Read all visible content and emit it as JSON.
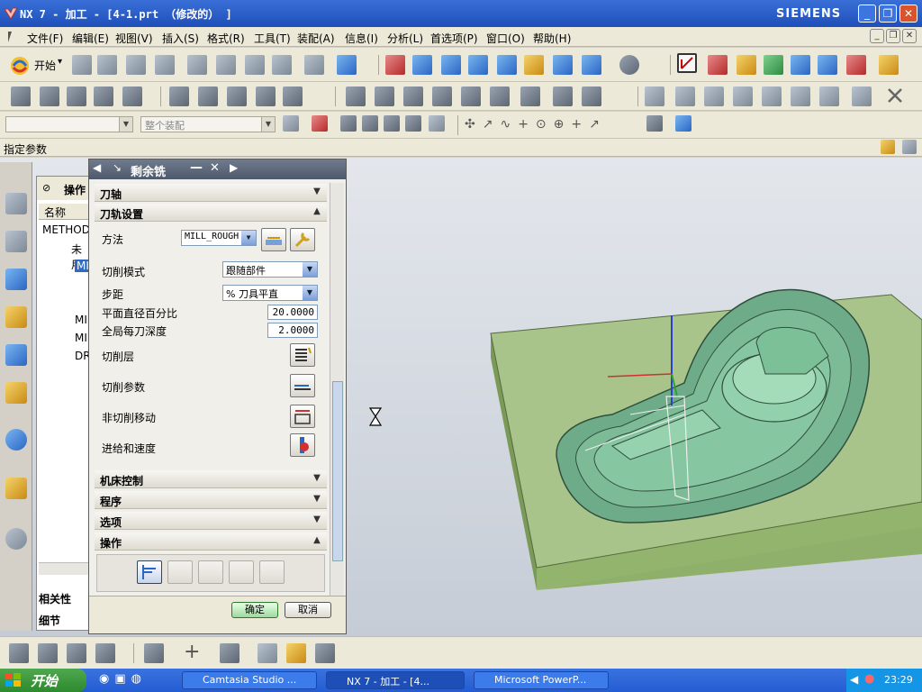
{
  "window": {
    "title": "NX 7 - 加工 - [4-1.prt （修改的） ]",
    "brand": "SIEMENS",
    "min": "_",
    "max": "❐",
    "close": "✕"
  },
  "menubar": {
    "items": [
      "文件(F)",
      "编辑(E)",
      "视图(V)",
      "插入(S)",
      "格式(R)",
      "工具(T)",
      "装配(A)",
      "信息(I)",
      "分析(L)",
      "首选项(P)",
      "窗口(O)",
      "帮助(H)"
    ]
  },
  "toolbar": {
    "start_label": "开始",
    "start_arrow": "▾",
    "filter_placeholder": "",
    "assembly_placeholder": "整个装配"
  },
  "cueline": {
    "text": "指定参数"
  },
  "navigator": {
    "header": "操作",
    "column_name": "名称",
    "items": [
      "METHOD",
      "未用",
      "MI",
      "MI",
      "MI",
      "DR"
    ]
  },
  "resource_tabs": {
    "bottom_labels": [
      "相关性",
      "细节"
    ]
  },
  "dialog": {
    "title": "剩余铣",
    "sections": {
      "tool_axis": "刀轴",
      "path_settings": "刀轨设置",
      "machine_control": "机床控制",
      "program": "程序",
      "options": "选项",
      "actions": "操作"
    },
    "method_label": "方法",
    "method_value": "MILL_ROUGH",
    "cut_pattern_label": "切削模式",
    "cut_pattern_value": "跟随部件",
    "stepover_label": "步距",
    "stepover_value": "% 刀具平直",
    "percent_label": "平面直径百分比",
    "percent_value": "20.0000",
    "depth_label": "全局每刀深度",
    "depth_value": "2.0000",
    "cut_levels_label": "切削层",
    "cut_params_label": "切削参数",
    "noncut_label": "非切削移动",
    "feeds_label": "进给和速度",
    "ok": "确定",
    "cancel": "取消"
  },
  "taskbar": {
    "start": "开始",
    "tasks": [
      "Camtasia Studio ...",
      "NX 7 - 加工 - [4...",
      "Microsoft PowerP..."
    ],
    "clock": "23:29"
  },
  "colors": {
    "titlebar": "#2757c6",
    "model_green": "#7fc09a",
    "plate_green": "#a9c48a",
    "dialog_bg": "#f0efe9"
  }
}
